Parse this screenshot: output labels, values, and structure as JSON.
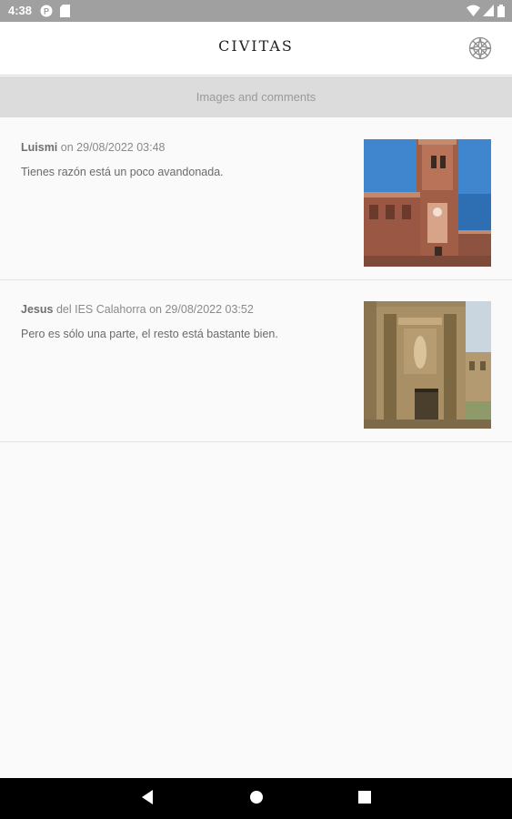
{
  "status_bar": {
    "time": "4:38"
  },
  "app_bar": {
    "title": "CIVITAS",
    "settings_icon": "compass-rose-icon"
  },
  "section": {
    "title": "Images and comments"
  },
  "comments": [
    {
      "author": "Luismi",
      "affiliation": "",
      "on_label": "on",
      "date": "29/08/2022 03:48",
      "text": "Tienes razón está un poco avandonada.",
      "image": "church-tower-photo"
    },
    {
      "author": "Jesus",
      "affiliation": "del IES Calahorra",
      "on_label": "on",
      "date": "29/08/2022 03:52",
      "text": "Pero es sólo una parte, el resto está bastante bien.",
      "image": "baroque-portal-photo"
    }
  ],
  "nav_bar": {
    "back_icon": "back-triangle-icon",
    "home_icon": "home-circle-icon",
    "recents_icon": "recents-square-icon"
  }
}
